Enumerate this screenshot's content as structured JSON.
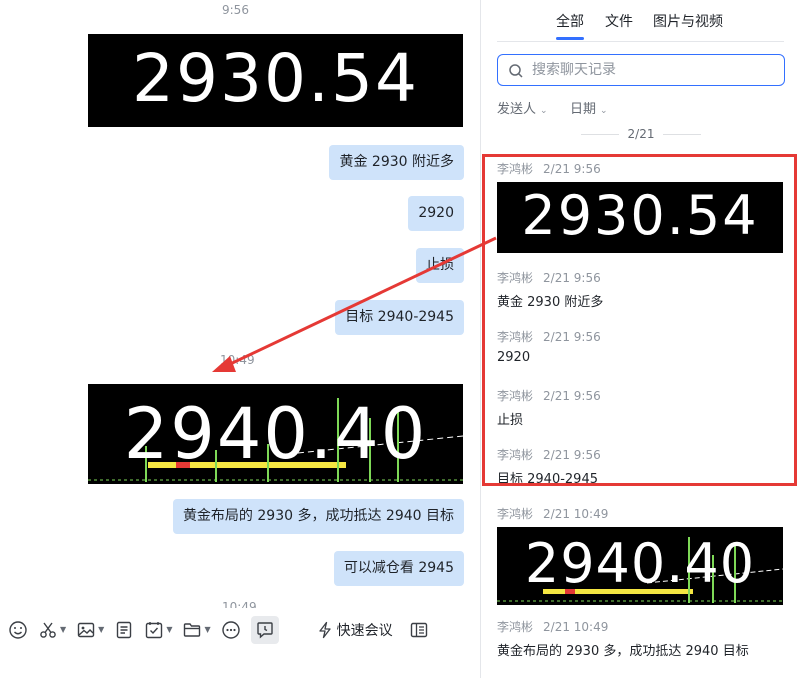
{
  "chat": {
    "timestamps": [
      "9:56",
      "10:49",
      "10:49"
    ],
    "image_messages": [
      "2930.54",
      "2940.40"
    ],
    "text_messages": [
      "黄金 2930 附近多",
      "2920",
      "止损",
      "目标 2940-2945",
      "黄金布局的 2930 多，成功抵达 2940 目标",
      "可以减仓看 2945"
    ]
  },
  "toolbar": {
    "icons": [
      "emoji-icon",
      "scissors-icon",
      "image-icon",
      "document-icon",
      "task-icon",
      "folder-icon",
      "more-icon",
      "message-icon"
    ],
    "quick_meeting_label": "快速会议"
  },
  "side": {
    "tabs": [
      "全部",
      "文件",
      "图片与视频"
    ],
    "active_tab": "全部",
    "search_placeholder": "搜索聊天记录",
    "filters": [
      "发送人",
      "日期"
    ],
    "date_group": "2/21",
    "results": [
      {
        "sender": "李鸿彬",
        "time": "2/21 9:56",
        "image": "2930.54"
      },
      {
        "sender": "李鸿彬",
        "time": "2/21 9:56",
        "text": "黄金 2930 附近多"
      },
      {
        "sender": "李鸿彬",
        "time": "2/21 9:56",
        "text": "2920"
      },
      {
        "sender": "李鸿彬",
        "time": "2/21 9:56",
        "text": "止损"
      },
      {
        "sender": "李鸿彬",
        "time": "2/21 9:56",
        "text": "目标 2940-2945"
      },
      {
        "sender": "李鸿彬",
        "time": "2/21 10:49",
        "image": "2940.40"
      },
      {
        "sender": "李鸿彬",
        "time": "2/21 10:49",
        "text": "黄金布局的 2930 多，成功抵达 2940 目标"
      }
    ]
  },
  "colors": {
    "accent": "#3370ff",
    "bubble": "#cfe3fa",
    "annotation": "#e53935"
  }
}
